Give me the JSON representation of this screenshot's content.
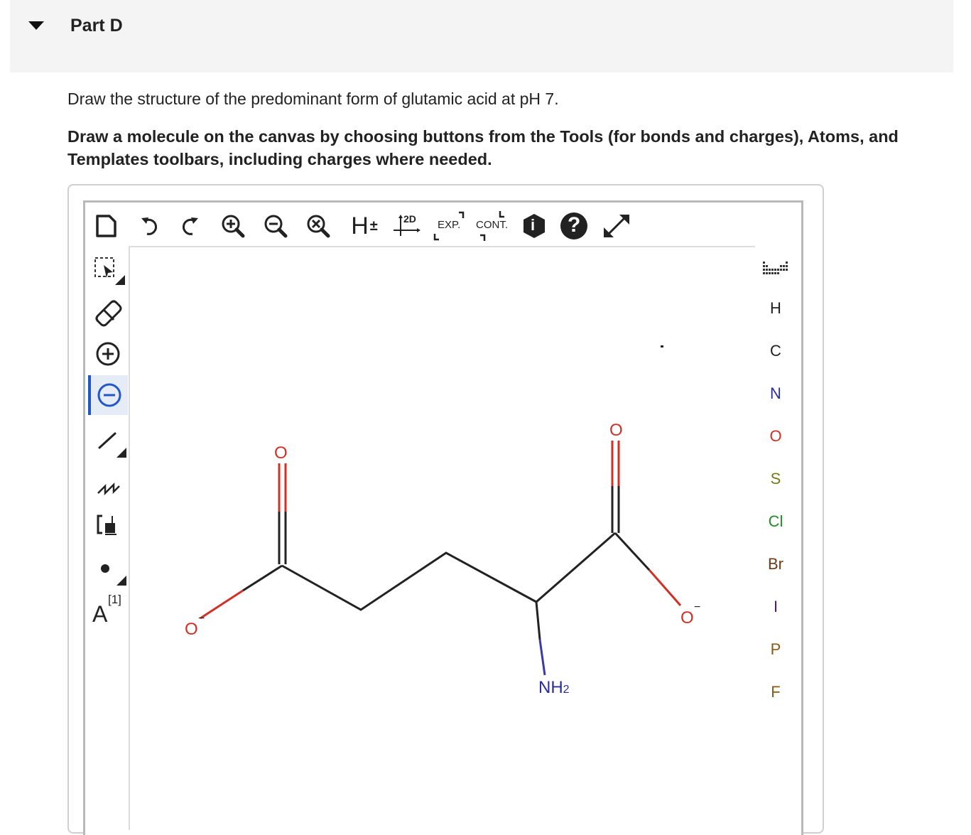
{
  "part": {
    "title": "Part D"
  },
  "question": "Draw the structure of the predominant form of glutamic acid at pH 7.",
  "instructions": "Draw a molecule on the canvas by choosing buttons from the Tools (for bonds and charges), Atoms, and Templates toolbars, including charges where needed.",
  "toolbar": {
    "h_label": "H",
    "h_sign": "±",
    "clean2d_label": "2D",
    "expand_label": "EXP.",
    "contract_label": "CONT.",
    "help_label": "?",
    "info_label": "i"
  },
  "tools": {
    "atom_map_letter": "A",
    "atom_map_index": "[1]"
  },
  "atoms": [
    "H",
    "C",
    "N",
    "O",
    "S",
    "Cl",
    "Br",
    "I",
    "P",
    "F"
  ],
  "atom_colors": {
    "H": "#222222",
    "C": "#222222",
    "N": "#2a2d9a",
    "O": "#d22f27",
    "S": "#7a7a1a",
    "Cl": "#238c23",
    "Br": "#6b3b1a",
    "I": "#4b1a6b",
    "P": "#8a5a14",
    "F": "#8a5a14"
  },
  "molecule": {
    "o_label": "O",
    "neg_charge": "−",
    "nh2_label": "NH",
    "nh2_sub": "2"
  },
  "colors": {
    "bond": "#222222",
    "oxygen": "#d22f27",
    "nitrogen": "#3a3aa8",
    "accent": "#2356c8"
  }
}
